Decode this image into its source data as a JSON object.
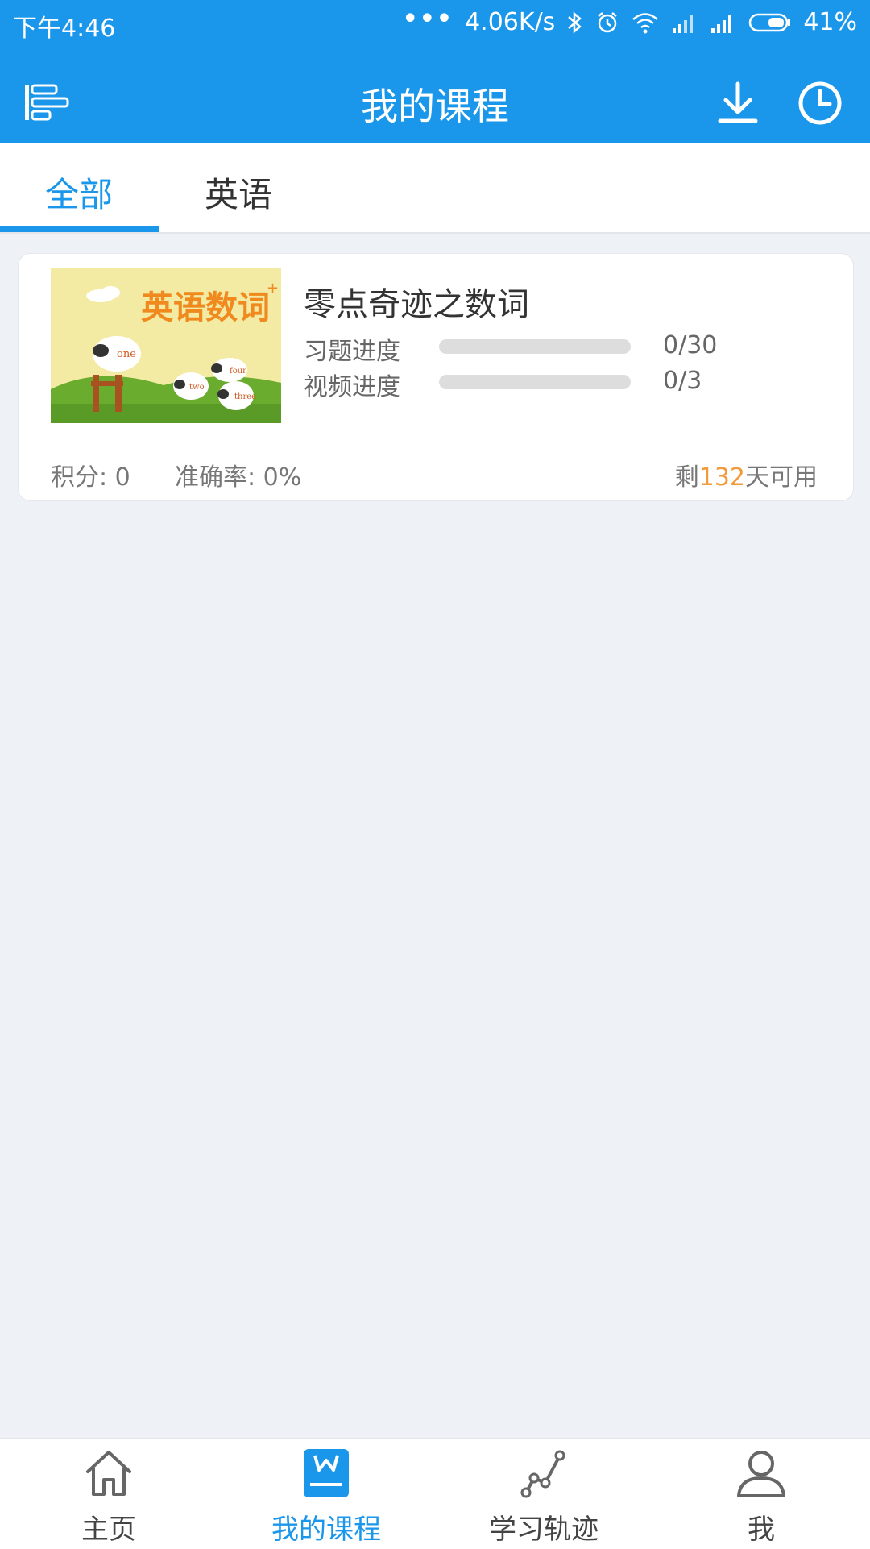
{
  "status_bar": {
    "time": "下午4:46",
    "dots": "•••",
    "speed": "4.06K/s",
    "battery": "41%"
  },
  "app_bar": {
    "title": "我的课程",
    "icons": [
      "menu-icon",
      "download-icon",
      "clock-icon"
    ]
  },
  "tabs": [
    {
      "label": "全部",
      "active": true
    },
    {
      "label": "英语",
      "active": false
    }
  ],
  "courses": [
    {
      "thumbnail_text": "英语数词",
      "thumbnail_words": [
        "one",
        "two",
        "four",
        "three"
      ],
      "title": "零点奇迹之数词",
      "exercise_label": "习题进度",
      "exercise_progress": "0/30",
      "exercise_fraction": 0,
      "video_label": "视频进度",
      "video_progress": "0/3",
      "video_fraction": 0,
      "score_text": "积分: 0",
      "accuracy_text": "准确率: 0%",
      "remain_prefix": "剩",
      "remain_days": "132",
      "remain_suffix": "天可用"
    }
  ],
  "bottom_nav": [
    {
      "label": "主页",
      "icon": "home-icon",
      "active": false
    },
    {
      "label": "我的课程",
      "icon": "course-book-icon",
      "active": true
    },
    {
      "label": "学习轨迹",
      "icon": "trend-icon",
      "active": false
    },
    {
      "label": "我",
      "icon": "user-icon",
      "active": false
    }
  ],
  "colors": {
    "primary": "#1a96ea",
    "accent_orange": "#f39a3c",
    "background": "#eef1f6"
  }
}
